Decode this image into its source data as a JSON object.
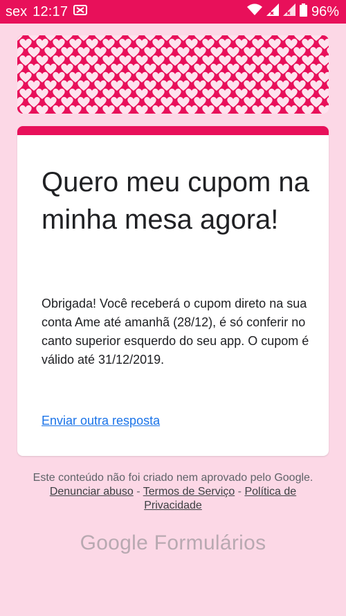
{
  "status_bar": {
    "day": "sex",
    "time": "12:17",
    "battery": "96%",
    "icons": [
      "notification-icon",
      "wifi-icon",
      "signal-icon",
      "signal-icon",
      "battery-icon"
    ]
  },
  "form": {
    "title": "Quero meu cupom na minha mesa agora!",
    "confirmation_message": "Obrigada! Você receberá o cupom direto na sua conta Ame até amanhã (28/12), é só conferir no canto superior esquerdo do seu app. O cupom é válido até 31/12/2019.",
    "another_response_link": "Enviar outra resposta"
  },
  "footer": {
    "note": "Este conteúdo não foi criado nem aprovado pelo Google.",
    "report_abuse": "Denunciar abuso",
    "terms": "Termos de Serviço",
    "privacy": "Política de Privacidade",
    "separator": "-"
  },
  "brand": {
    "google": "Google",
    "forms": "Formulários"
  },
  "colors": {
    "accent": "#e8105a",
    "background": "#fcd8e6",
    "link": "#1a73e8"
  }
}
